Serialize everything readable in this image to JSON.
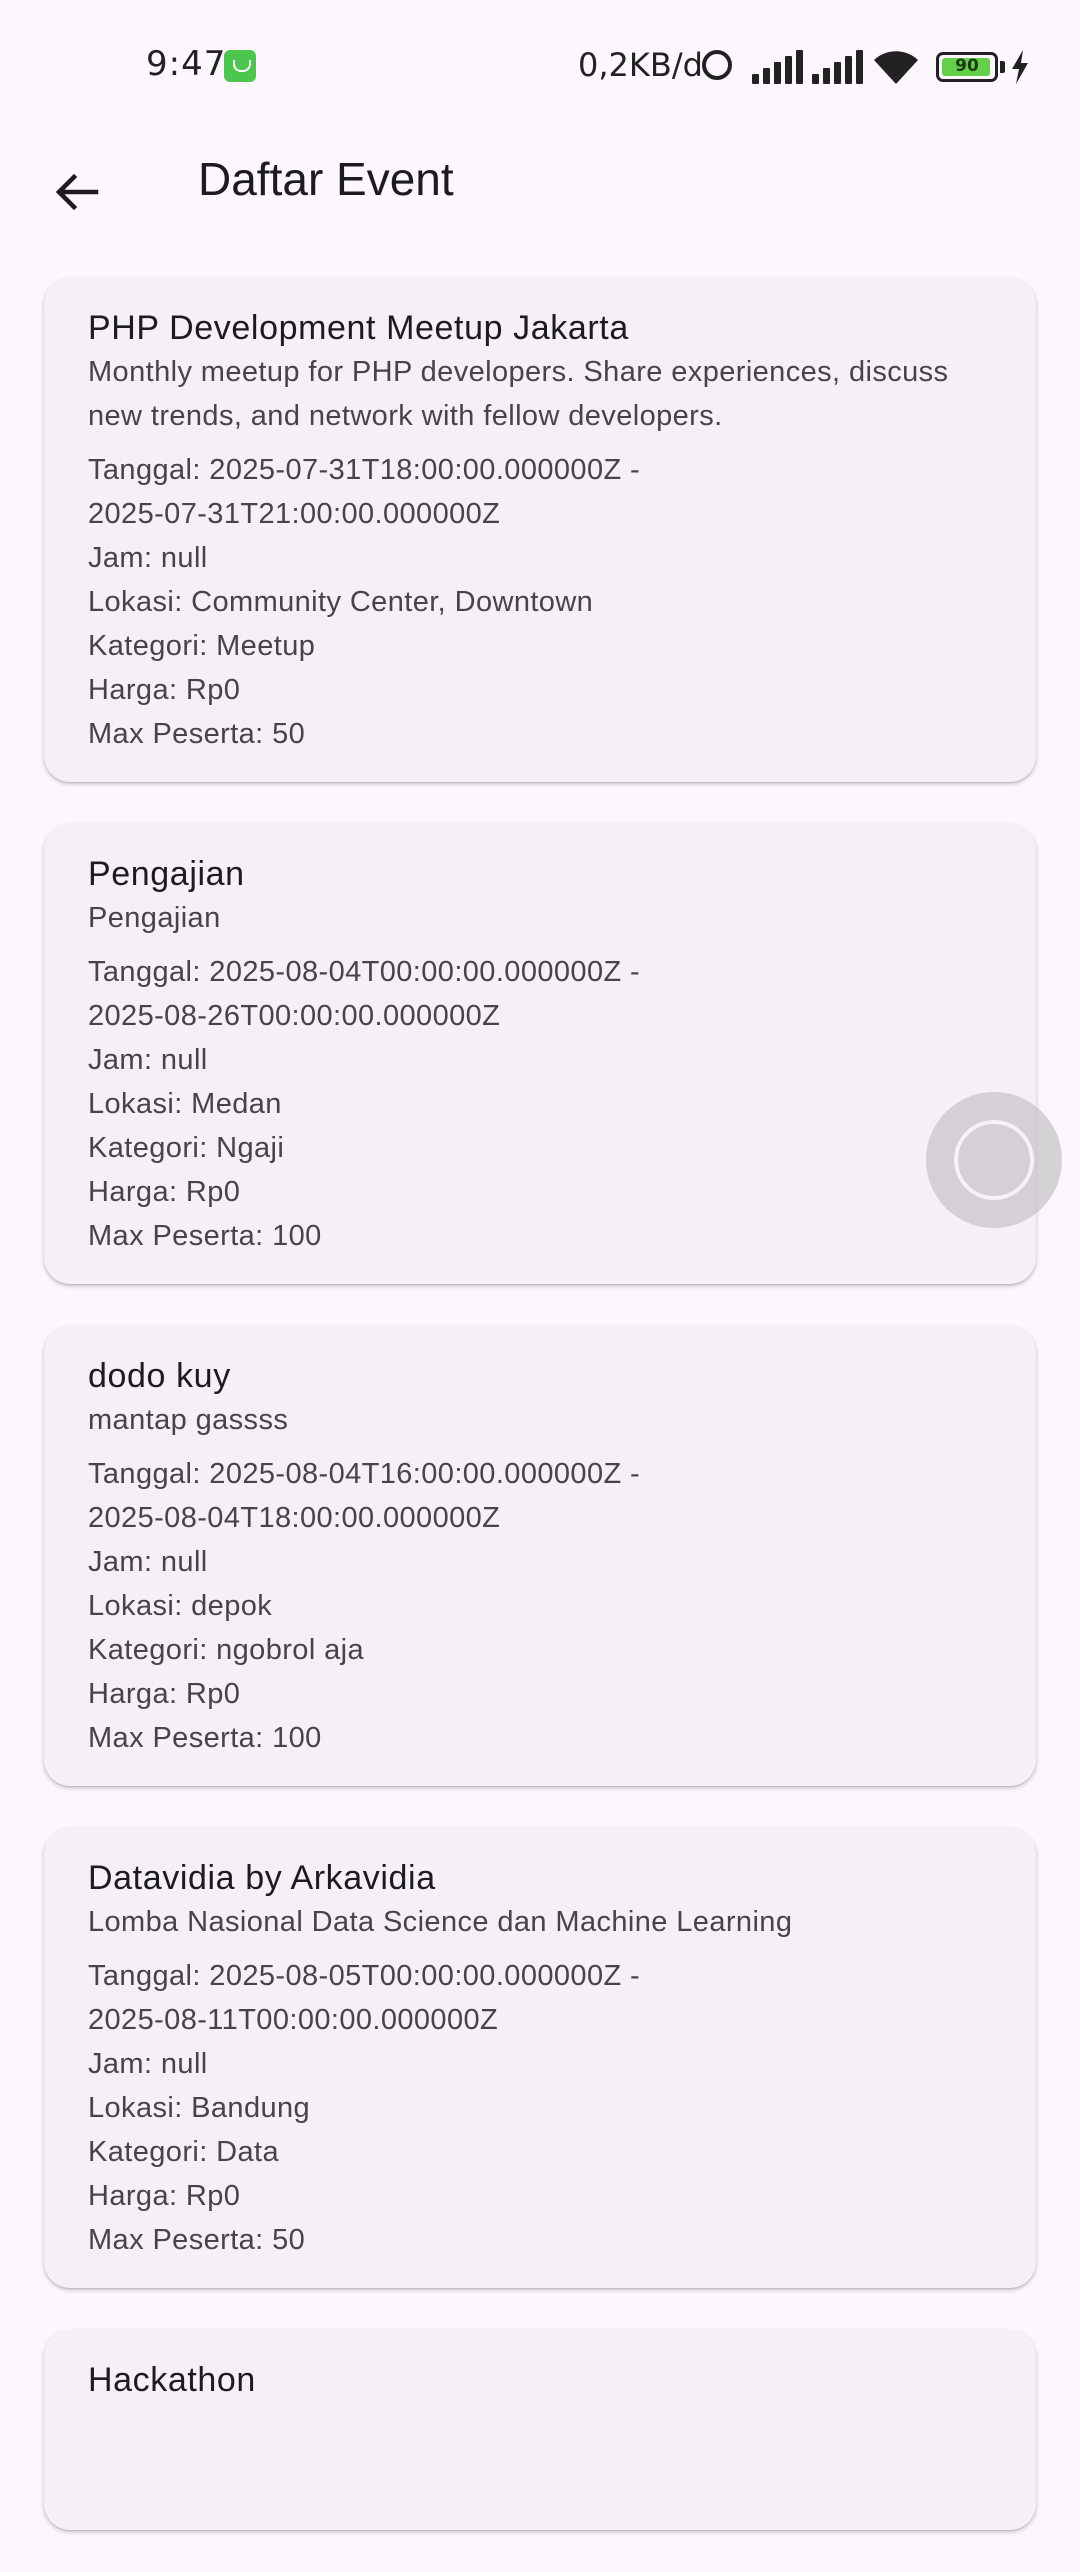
{
  "status_bar": {
    "time": "9:47",
    "network_speed": "0,2KB/d",
    "battery_level": "90",
    "icons": [
      "app-notification-icon",
      "alarm-icon",
      "signal-icon",
      "signal-icon",
      "wifi-icon",
      "battery-icon",
      "charging-icon"
    ]
  },
  "app_bar": {
    "back_icon": "arrow-left-icon",
    "title": "Daftar Event"
  },
  "events": [
    {
      "title": "PHP Development Meetup Jakarta",
      "description": "Monthly meetup for PHP developers. Share experiences, discuss new trends, and network with fellow developers.",
      "tanggal_1": "Tanggal: 2025-07-31T18:00:00.000000Z -",
      "tanggal_2": "2025-07-31T21:00:00.000000Z",
      "jam": "Jam: null",
      "lokasi": "Lokasi: Community Center, Downtown",
      "kategori": "Kategori: Meetup",
      "harga": "Harga: Rp0",
      "max_peserta": "Max Peserta: 50"
    },
    {
      "title": "Pengajian",
      "description": "Pengajian",
      "tanggal_1": "Tanggal: 2025-08-04T00:00:00.000000Z -",
      "tanggal_2": "2025-08-26T00:00:00.000000Z",
      "jam": "Jam: null",
      "lokasi": "Lokasi: Medan",
      "kategori": "Kategori: Ngaji",
      "harga": "Harga: Rp0",
      "max_peserta": "Max Peserta: 100"
    },
    {
      "title": "dodo kuy",
      "description": "mantap gassss",
      "tanggal_1": "Tanggal: 2025-08-04T16:00:00.000000Z -",
      "tanggal_2": "2025-08-04T18:00:00.000000Z",
      "jam": "Jam: null",
      "lokasi": "Lokasi: depok",
      "kategori": "Kategori: ngobrol aja",
      "harga": "Harga: Rp0",
      "max_peserta": "Max Peserta: 100"
    },
    {
      "title": "Datavidia by Arkavidia",
      "description": "Lomba Nasional Data Science dan Machine Learning",
      "tanggal_1": "Tanggal: 2025-08-05T00:00:00.000000Z -",
      "tanggal_2": "2025-08-11T00:00:00.000000Z",
      "jam": "Jam: null",
      "lokasi": "Lokasi: Bandung",
      "kategori": "Kategori: Data",
      "harga": "Harga: Rp0",
      "max_peserta": "Max Peserta: 50"
    },
    {
      "title": "Hackathon"
    }
  ]
}
